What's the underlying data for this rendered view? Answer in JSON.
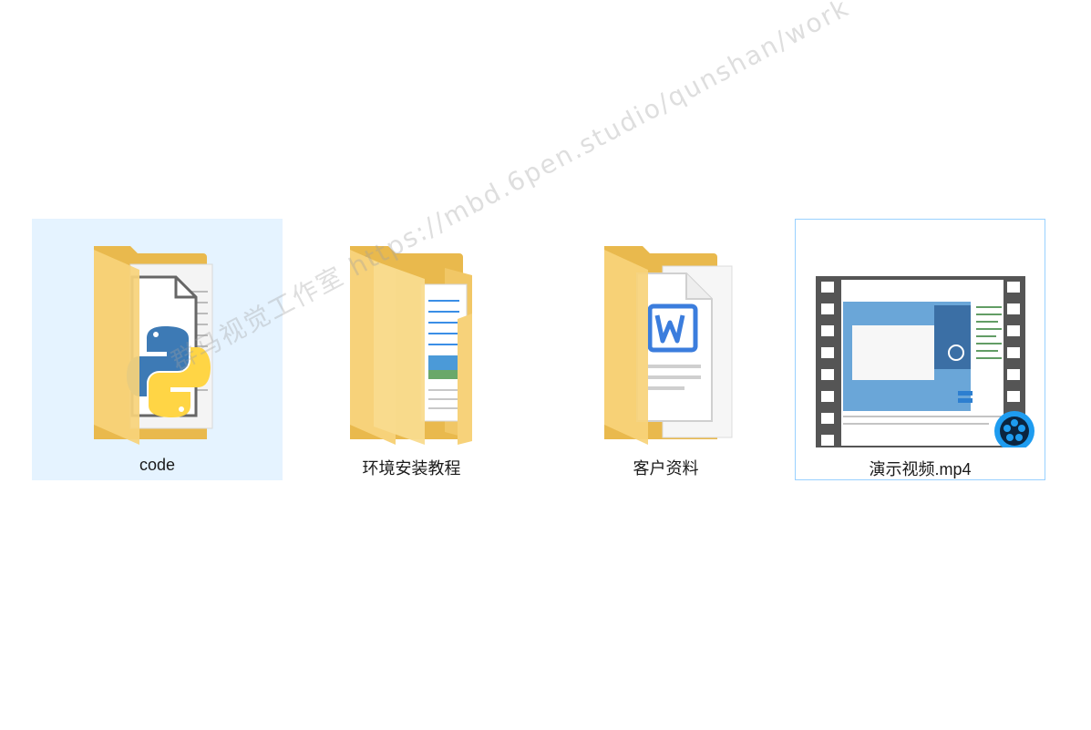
{
  "items": [
    {
      "name": "code",
      "type": "folder",
      "preview": "python-icon",
      "selected": true
    },
    {
      "name": "环境安装教程",
      "type": "folder",
      "preview": "document-image-icon",
      "selected": false
    },
    {
      "name": "客户资料",
      "type": "folder",
      "preview": "word-document-icon",
      "selected": false
    },
    {
      "name": "演示视频.mp4",
      "type": "video",
      "preview": "video-thumbnail-icon",
      "selected": false,
      "focused": true
    }
  ],
  "watermark": "群马视觉工作室 https://mbd.6pen.studio/qunshan/work",
  "colors": {
    "selection_bg": "#e5f3ff",
    "focus_border": "#99d1ff",
    "folder_back": "#f3c96b",
    "folder_front": "#fbe09a",
    "python_blue": "#3d7ab5",
    "python_yellow": "#ffd545",
    "word_blue": "#3b7ddd",
    "player_blue": "#1e9cf0"
  }
}
